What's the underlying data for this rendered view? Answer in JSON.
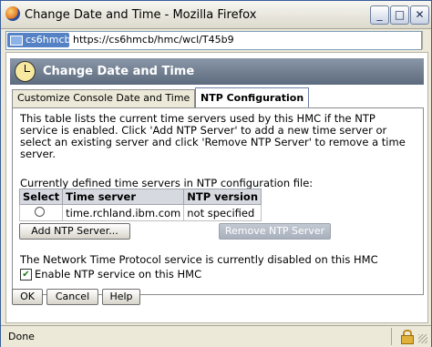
{
  "window": {
    "title": "Change Date and Time - Mozilla Firefox",
    "controls": {
      "minimize": "_",
      "maximize": "□",
      "close": "✕"
    }
  },
  "address_bar": {
    "site_label": "cs6hmcb",
    "url": "https://cs6hmcb/hmc/wcl/T45b9"
  },
  "page": {
    "header_title": "Change Date and Time",
    "tabs": [
      {
        "label": "Customize Console Date and Time",
        "selected": false
      },
      {
        "label": "NTP Configuration",
        "selected": true
      }
    ],
    "description": "This table lists the current time servers used by this HMC if the NTP service is enabled. Click 'Add NTP Server' to add a new time server or select an existing server and click 'Remove NTP Server' to remove a time server.",
    "table_caption": "Currently defined time servers in NTP configuration file:",
    "table": {
      "headers": [
        "Select",
        "Time server",
        "NTP version"
      ],
      "rows": [
        {
          "selected": false,
          "time_server": "time.rchland.ibm.com",
          "ntp_version": "not specified"
        }
      ]
    },
    "buttons": {
      "add_ntp": "Add NTP Server...",
      "remove_ntp": "Remove NTP Server",
      "ok": "OK",
      "cancel": "Cancel",
      "help": "Help"
    },
    "service_status": "The Network Time Protocol service is currently disabled on this HMC",
    "enable_checkbox": {
      "label": "Enable NTP service on this HMC",
      "checked": true
    }
  },
  "status_bar": {
    "text": "Done"
  },
  "colors": {
    "header_bg": "#6b788b",
    "selected_tab_border": "#6d7fa6",
    "window_border": "#3a5f9c",
    "disabled_button": "#a8b0bd"
  }
}
